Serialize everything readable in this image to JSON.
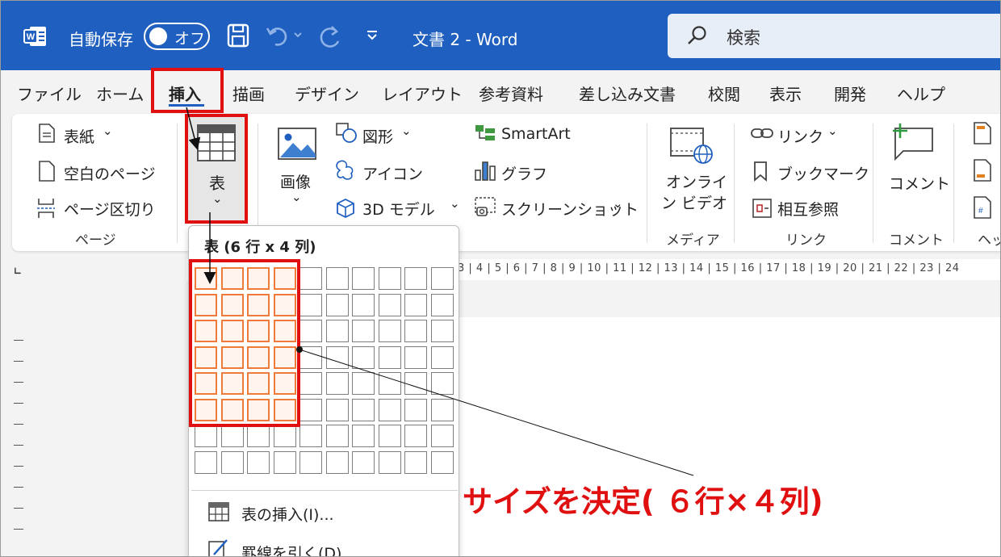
{
  "titlebar": {
    "autosave_label": "自動保存",
    "autosave_state": "オフ",
    "doc_title": "文書 2  -  Word",
    "search_placeholder": "検索",
    "color": "#1f5fbf"
  },
  "tabs": [
    "ファイル",
    "ホーム",
    "挿入",
    "描画",
    "デザイン",
    "レイアウト",
    "参考資料",
    "差し込み文書",
    "校閲",
    "表示",
    "開発",
    "ヘルプ"
  ],
  "active_tab": "挿入",
  "ribbon": {
    "pages": {
      "cover": "表紙",
      "blank": "空白のページ",
      "break": "ページ区切り",
      "group": "ページ"
    },
    "table": {
      "label": "表"
    },
    "illustrations": {
      "picture": "画像",
      "shapes": "図形",
      "icons": "アイコン",
      "model3d": "3D モデル",
      "smartart": "SmartArt",
      "chart": "グラフ",
      "screenshot": "スクリーンショット"
    },
    "media": {
      "online_video_line1": "オンライ",
      "online_video_line2": "ン ビデオ",
      "group": "メディア"
    },
    "links": {
      "link": "リンク",
      "bookmark": "ブックマーク",
      "cross_ref": "相互参照",
      "group": "リンク"
    },
    "comments": {
      "comment": "コメント",
      "group": "コメント"
    },
    "header_group_partial": "ヘッ"
  },
  "ruler": {
    "text": "3 | 4 | 5 | 6 | 7 | 8 | 9 | 10 | 11 | 12 | 13 | 14 | 15 | 16 | 17 | 18 | 19 | 20 | 21 | 22 | 23 | 24"
  },
  "table_dropdown": {
    "title": "表 (6 行 x 4 列)",
    "grid_rows": 8,
    "grid_cols": 10,
    "selected_rows": 6,
    "selected_cols": 4,
    "insert_table": "表の挿入(I)...",
    "draw_table": "罫線を引く(D)"
  },
  "annotation": {
    "text": "サイズを決定( ６行×４列)",
    "color": "#e01010"
  }
}
